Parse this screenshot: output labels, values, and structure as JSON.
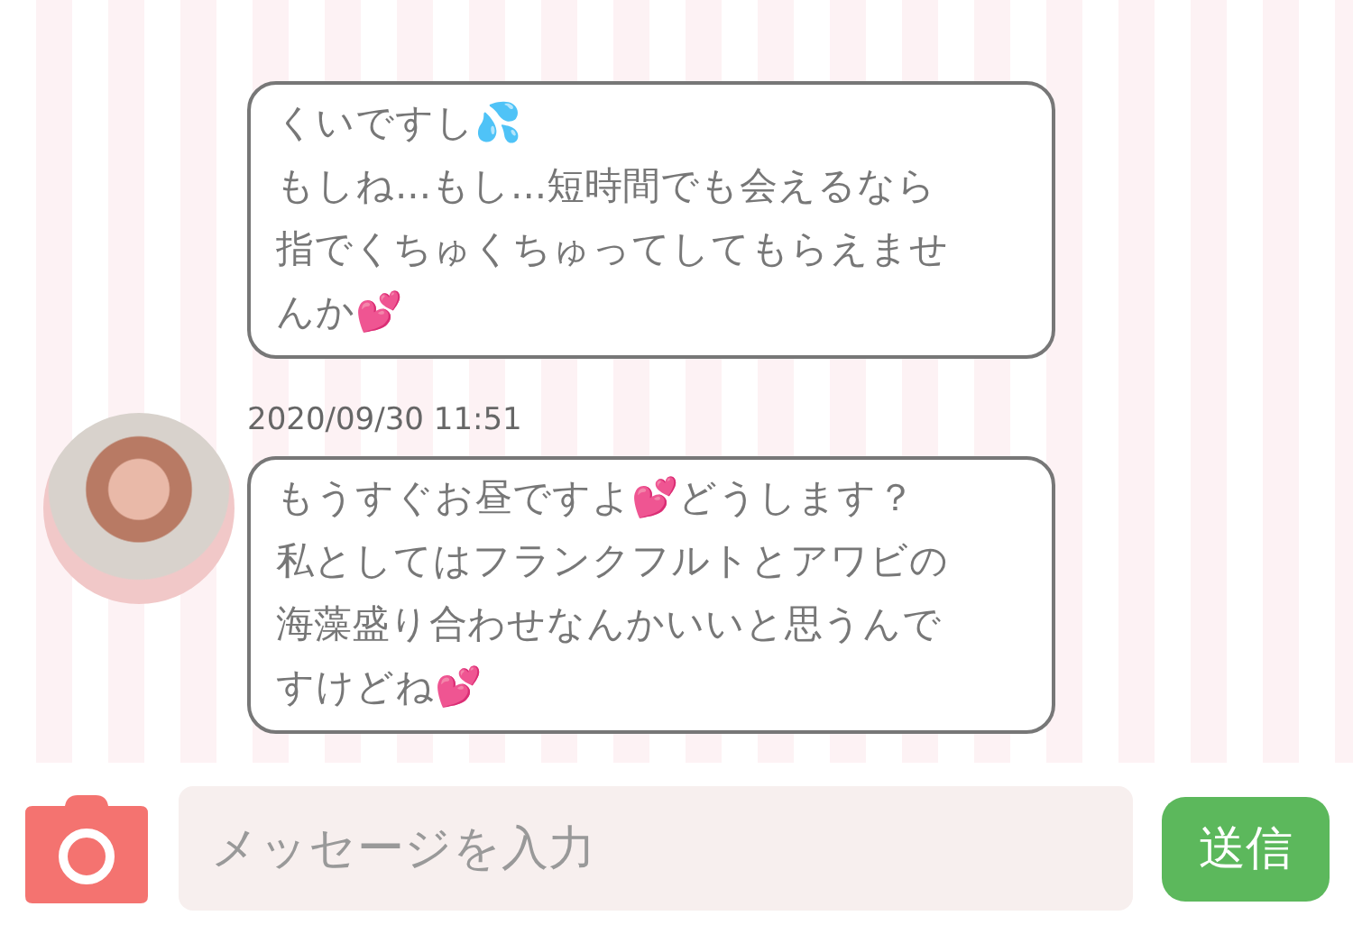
{
  "messages": [
    {
      "lines": [
        "くいですし💦",
        "もしね...もし...短時間でも会えるなら",
        "指でくちゅくちゅってしてもらえませ",
        "んか💕"
      ]
    },
    {
      "timestamp": "2020/09/30 11:51",
      "lines": [
        "もうすぐお昼ですよ💕どうします？",
        "私としてはフランクフルトとアワビの",
        "海藻盛り合わせなんかいいと思うんで",
        "すけどね💕"
      ]
    }
  ],
  "composer": {
    "placeholder": "メッセージを入力",
    "send_label": "送信"
  }
}
